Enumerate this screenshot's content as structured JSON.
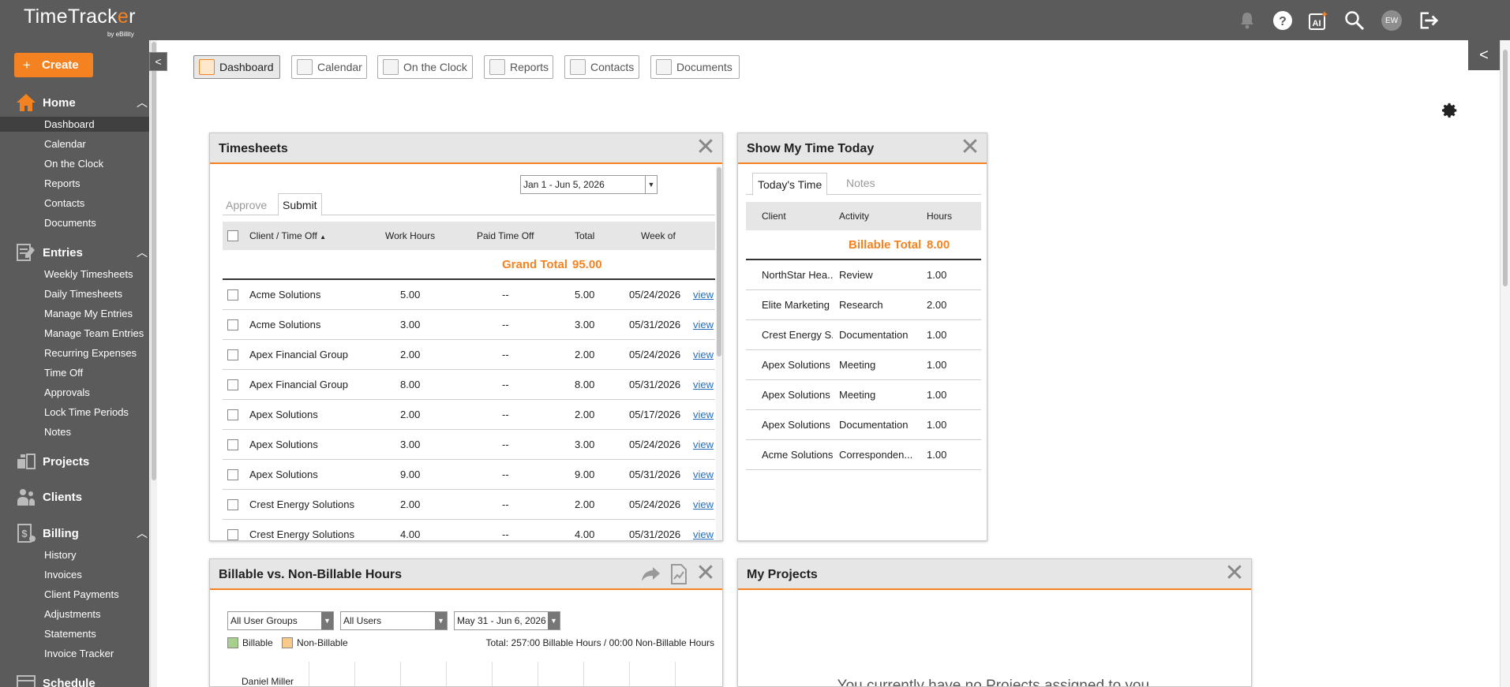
{
  "app": {
    "logo_text_pre": "TimeTrack",
    "logo_text_o": "e",
    "logo_text_post": "r",
    "logo_sub": "by eBillity"
  },
  "header": {
    "avatar_initials": "EW"
  },
  "sidebar": {
    "create_label": "Create",
    "home": {
      "label": "Home",
      "items": [
        "Dashboard",
        "Calendar",
        "On the Clock",
        "Reports",
        "Contacts",
        "Documents"
      ]
    },
    "entries": {
      "label": "Entries",
      "items": [
        "Weekly Timesheets",
        "Daily Timesheets",
        "Manage My Entries",
        "Manage Team Entries",
        "Recurring Expenses",
        "Time Off",
        "Approvals",
        "Lock Time Periods",
        "Notes"
      ]
    },
    "projects": {
      "label": "Projects"
    },
    "clients": {
      "label": "Clients"
    },
    "billing": {
      "label": "Billing",
      "items": [
        "History",
        "Invoices",
        "Client Payments",
        "Adjustments",
        "Statements",
        "Invoice Tracker"
      ]
    },
    "schedule": {
      "label": "Schedule"
    }
  },
  "tabs": [
    "Dashboard",
    "Calendar",
    "On the Clock",
    "Reports",
    "Contacts",
    "Documents"
  ],
  "timesheets": {
    "title": "Timesheets",
    "date_range": "Jan 1 - Jun 5, 2026",
    "subtabs": [
      "Approve",
      "Submit"
    ],
    "columns": {
      "client": "Client / Time Off",
      "work": "Work Hours",
      "paid": "Paid Time Off",
      "total": "Total",
      "week": "Week of"
    },
    "grand_total_label": "Grand Total",
    "grand_total_value": "95.00",
    "view_label": "view",
    "rows": [
      {
        "client": "Acme Solutions",
        "work": "5.00",
        "paid": "--",
        "total": "5.00",
        "week": "05/24/2026"
      },
      {
        "client": "Acme Solutions",
        "work": "3.00",
        "paid": "--",
        "total": "3.00",
        "week": "05/31/2026"
      },
      {
        "client": "Apex Financial Group",
        "work": "2.00",
        "paid": "--",
        "total": "2.00",
        "week": "05/24/2026"
      },
      {
        "client": "Apex Financial Group",
        "work": "8.00",
        "paid": "--",
        "total": "8.00",
        "week": "05/31/2026"
      },
      {
        "client": "Apex Solutions",
        "work": "2.00",
        "paid": "--",
        "total": "2.00",
        "week": "05/17/2026"
      },
      {
        "client": "Apex Solutions",
        "work": "3.00",
        "paid": "--",
        "total": "3.00",
        "week": "05/24/2026"
      },
      {
        "client": "Apex Solutions",
        "work": "9.00",
        "paid": "--",
        "total": "9.00",
        "week": "05/31/2026"
      },
      {
        "client": "Crest Energy Solutions",
        "work": "2.00",
        "paid": "--",
        "total": "2.00",
        "week": "05/24/2026"
      },
      {
        "client": "Crest Energy Solutions",
        "work": "4.00",
        "paid": "--",
        "total": "4.00",
        "week": "05/31/2026"
      }
    ]
  },
  "today": {
    "title": "Show My Time Today",
    "subtabs": [
      "Today's Time",
      "Notes"
    ],
    "columns": {
      "client": "Client",
      "activity": "Activity",
      "hours": "Hours"
    },
    "billable_total_label": "Billable Total",
    "billable_total_value": "8.00",
    "rows": [
      {
        "client": "NorthStar Hea...",
        "activity": "Review",
        "hours": "1.00"
      },
      {
        "client": "Elite Marketing",
        "activity": "Research",
        "hours": "2.00"
      },
      {
        "client": "Crest Energy S...",
        "activity": "Documentation",
        "hours": "1.00"
      },
      {
        "client": "Apex Solutions",
        "activity": "Meeting",
        "hours": "1.00"
      },
      {
        "client": "Apex Solutions",
        "activity": "Meeting",
        "hours": "1.00"
      },
      {
        "client": "Apex Solutions",
        "activity": "Documentation",
        "hours": "1.00"
      },
      {
        "client": "Acme Solutions",
        "activity": "Corresponden...",
        "hours": "1.00"
      }
    ]
  },
  "billable": {
    "title": "Billable vs. Non-Billable Hours",
    "group_select": "All User Groups",
    "user_select": "All Users",
    "date_select": "May 31 - Jun 6, 2026",
    "legend_billable": "Billable",
    "legend_nonbillable": "Non-Billable",
    "total_text": "Total: 257:00 Billable Hours / 00:00 Non-Billable Hours",
    "first_user": "Daniel Miller",
    "colors": {
      "billable": "#a8d08d",
      "nonbillable": "#f9c98a"
    }
  },
  "projects": {
    "title": "My Projects",
    "empty_text": "You currently have no Projects assigned to you."
  },
  "colors": {
    "accent": "#f58220",
    "sidebar": "#5b5b5b",
    "link": "#2a6ebb"
  }
}
